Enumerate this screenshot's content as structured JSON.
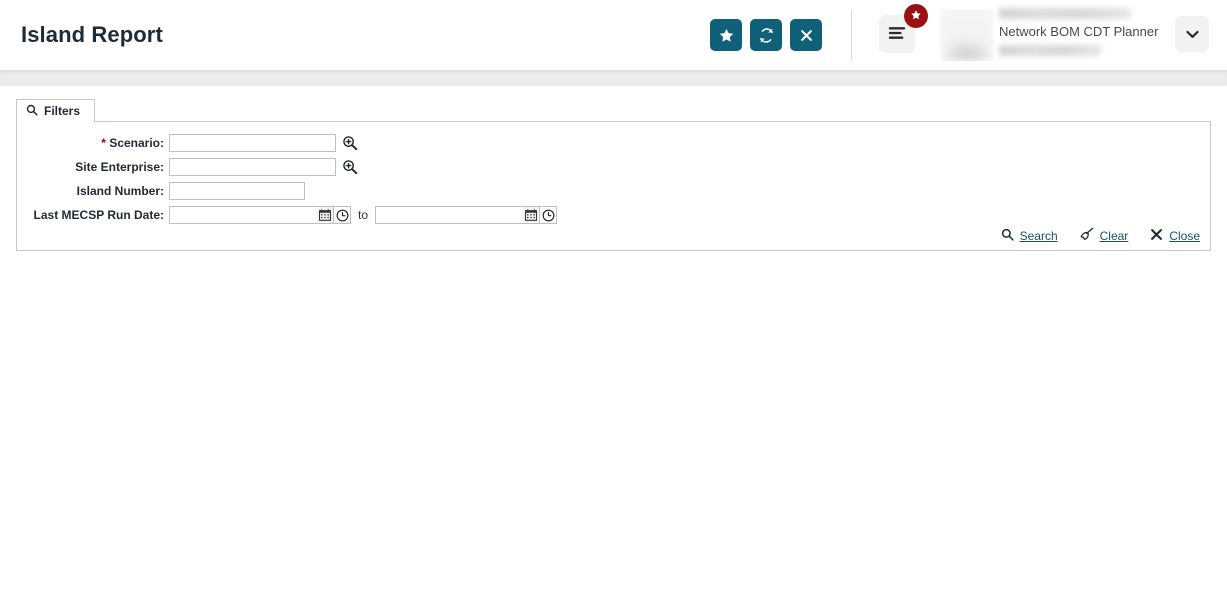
{
  "header": {
    "title": "Island Report",
    "actions": [
      {
        "name": "favorite-button",
        "icon": "star-icon"
      },
      {
        "name": "refresh-button",
        "icon": "refresh-icon"
      },
      {
        "name": "close-button",
        "icon": "close-icon"
      }
    ],
    "menu": {
      "icon": "hamburger-menu-icon",
      "badge_icon": "star-badge-icon"
    },
    "user": {
      "avatar_icon": "user-avatar",
      "name_redacted": "",
      "role": "Network BOM CDT Planner",
      "detail_redacted": "",
      "caret_icon": "chevron-down-icon"
    }
  },
  "filters": {
    "tab_label": "Filters",
    "tab_icon": "search-icon",
    "fields": {
      "scenario": {
        "required_marker": "*",
        "label": "Scenario:",
        "value": "",
        "placeholder": "",
        "lookup_icon": "zoom-in-lookup-icon"
      },
      "site_enterprise": {
        "label": "Site Enterprise:",
        "value": "",
        "placeholder": "",
        "lookup_icon": "zoom-in-lookup-icon"
      },
      "island_number": {
        "label": "Island Number:",
        "value": "",
        "placeholder": ""
      },
      "last_mecsp_run_date": {
        "label": "Last MECSP Run Date:",
        "from_value": "",
        "from_placeholder": "",
        "separator": "to",
        "to_value": "",
        "to_placeholder": "",
        "calendar_icon": "calendar-icon",
        "clock_icon": "clock-icon"
      }
    },
    "actions": [
      {
        "name": "search-link",
        "label": "Search",
        "icon": "search-icon"
      },
      {
        "name": "clear-link",
        "label": "Clear",
        "icon": "broom-icon"
      },
      {
        "name": "close-link",
        "label": "Close",
        "icon": "close-x-icon"
      }
    ]
  },
  "colors": {
    "accent_teal": "#116079",
    "badge_red": "#9b1111",
    "link_blue": "#1b4f72",
    "required_red": "#b00000",
    "title_dark": "#1d2b36"
  }
}
